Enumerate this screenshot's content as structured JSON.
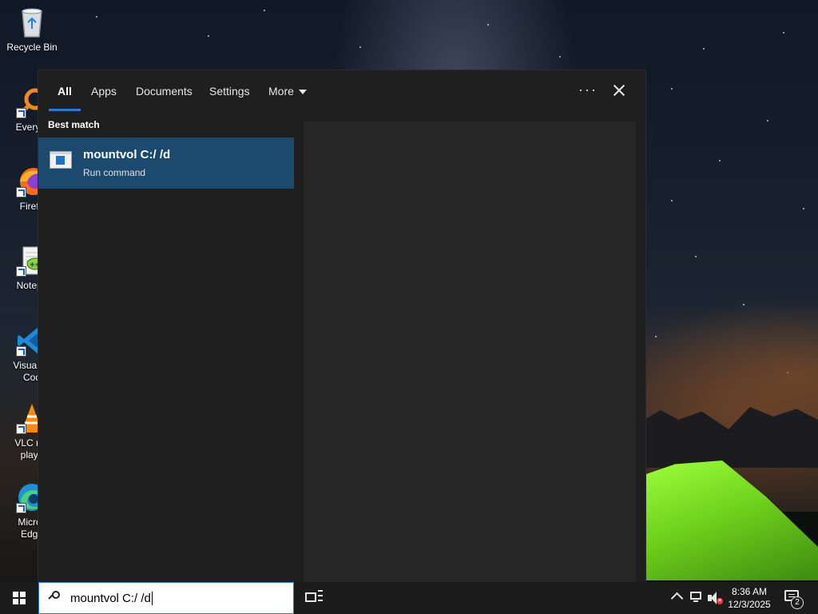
{
  "desktop": {
    "icons": [
      {
        "label": "Recycle Bin",
        "icon": "recycle-bin-icon"
      },
      {
        "label": "Everyth",
        "icon": "everything-search-icon"
      },
      {
        "label": "Firefo",
        "icon": "firefox-icon"
      },
      {
        "label": "Notepa",
        "icon": "notepad-plus-plus-icon"
      },
      {
        "label": "Visual St\nCod",
        "icon": "vscode-icon"
      },
      {
        "label": "VLC me\nplaye",
        "icon": "vlc-icon"
      },
      {
        "label": "Micros\nEdge",
        "icon": "edge-icon"
      }
    ]
  },
  "search_panel": {
    "tabs": [
      "All",
      "Apps",
      "Documents",
      "Settings",
      "More"
    ],
    "active_tab": "All",
    "best_match_label": "Best match",
    "result": {
      "title": "mountvol C:/ /d",
      "subtitle": "Run command",
      "icon": "run-command-icon"
    }
  },
  "taskbar": {
    "search_query": "mountvol C:/ /d",
    "clock_time": "8:36 AM",
    "clock_date": "12/3/2025",
    "notification_count": "2"
  },
  "colors": {
    "accent": "#2b7bd5",
    "selected_result": "#1c4a6e",
    "panel": "#1f1f1f",
    "taskbar": "#1c1c1c"
  }
}
